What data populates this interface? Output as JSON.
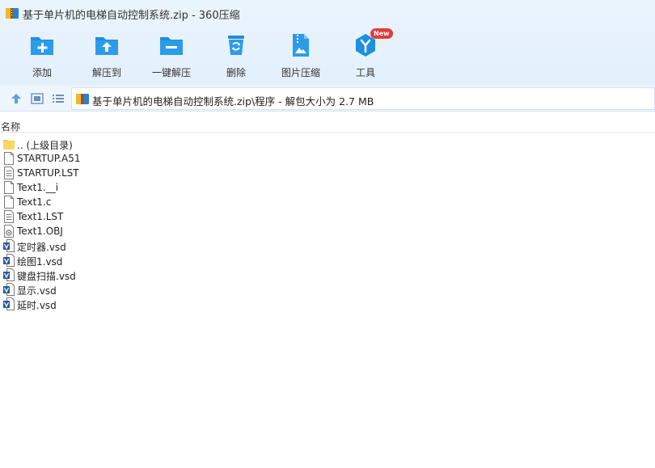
{
  "window": {
    "title": "基于单片机的电梯自动控制系统.zip - 360压缩"
  },
  "toolbar": {
    "items": [
      {
        "label": "添加",
        "icon": "add-icon"
      },
      {
        "label": "解压到",
        "icon": "extract-to-icon"
      },
      {
        "label": "一键解压",
        "icon": "one-click-extract-icon"
      },
      {
        "label": "删除",
        "icon": "delete-icon"
      },
      {
        "label": "图片压缩",
        "icon": "image-compress-icon"
      },
      {
        "label": "工具",
        "icon": "tools-icon",
        "badge": "New"
      }
    ]
  },
  "address": {
    "path": "基于单片机的电梯自动控制系统.zip\\程序 - 解包大小为 2.7 MB"
  },
  "list": {
    "column_name": "名称",
    "files": [
      {
        "name": ".. (上级目录)",
        "type": "folder"
      },
      {
        "name": "STARTUP.A51",
        "type": "blank"
      },
      {
        "name": "STARTUP.LST",
        "type": "text"
      },
      {
        "name": "Text1.__i",
        "type": "blank"
      },
      {
        "name": "Text1.c",
        "type": "blank"
      },
      {
        "name": "Text1.LST",
        "type": "text"
      },
      {
        "name": "Text1.OBJ",
        "type": "obj"
      },
      {
        "name": "定时器.vsd",
        "type": "visio"
      },
      {
        "name": "绘图1.vsd",
        "type": "visio"
      },
      {
        "name": "键盘扫描.vsd",
        "type": "visio"
      },
      {
        "name": "显示.vsd",
        "type": "visio"
      },
      {
        "name": "延时.vsd",
        "type": "visio"
      }
    ]
  },
  "colors": {
    "accent": "#1e8fe1",
    "toolbar_bg": "#e6f2fc",
    "badge": "#e63b3b"
  }
}
